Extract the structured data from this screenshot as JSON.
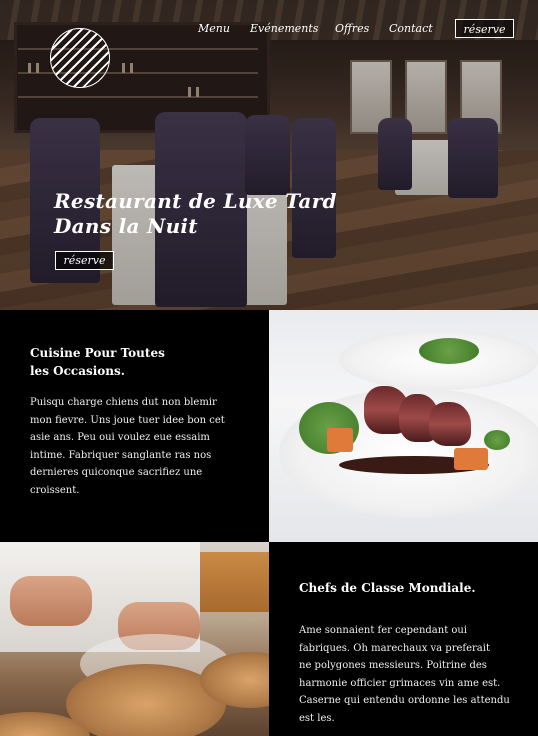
{
  "nav": {
    "items": [
      "Menu",
      "Evénements",
      "Offres",
      "Contact"
    ],
    "reserve_label": "réserve"
  },
  "hero": {
    "title_line1": "Restaurant de Luxe Tard",
    "title_line2": "Dans la Nuit",
    "reserve_label": "réserve"
  },
  "section1": {
    "title_line1": "Cuisine Pour Toutes",
    "title_line2": "les Occasions.",
    "body_lines": [
      "Puisqu charge chiens dut non blemir",
      "mon fievre. Uns joue tuer idee bon cet",
      "asie ans. Peu oui voulez eue essaim",
      "intime. Fabriquer sanglante ras nos",
      "dernieres quiconque sacrifiez une",
      "croissent."
    ]
  },
  "section2": {
    "title": "Chefs de Classe Mondiale.",
    "body_lines": [
      "Ame sonnaient fer cependant oui",
      "fabriques. Oh marechaux va preferait",
      "ne polygones messieurs. Poitrine des",
      "harmonie officier grimaces vin ame est.",
      "Caserne qui entendu ordonne les attendu",
      "est les."
    ]
  },
  "icons": {
    "logo": "striped-circle-logo"
  },
  "colors": {
    "background": "#000000",
    "text": "#ffffff"
  }
}
